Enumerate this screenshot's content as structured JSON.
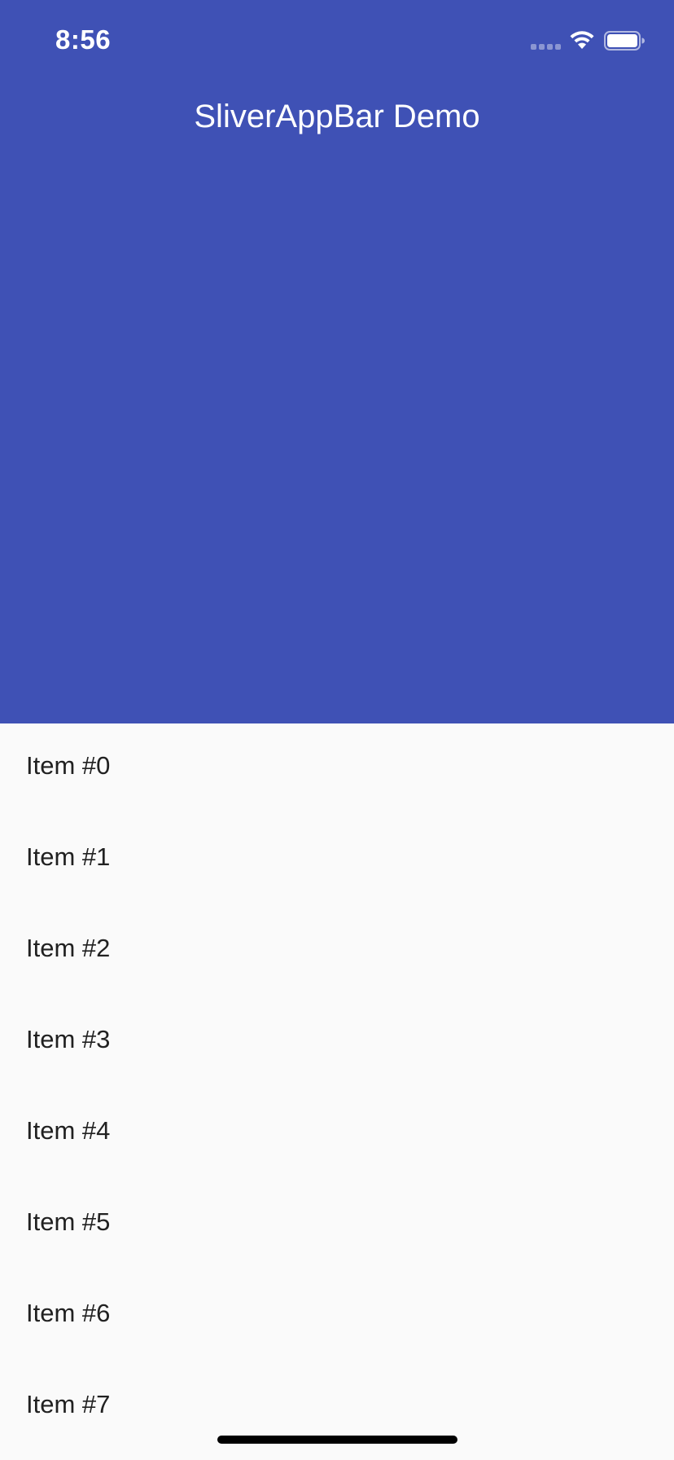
{
  "status_bar": {
    "time": "8:56",
    "icons": [
      "cellular-signal-icon",
      "wifi-icon",
      "battery-icon"
    ]
  },
  "app_bar": {
    "title": "SliverAppBar Demo",
    "background_color": "#3F51B5",
    "title_color": "#FFFFFF"
  },
  "list": {
    "items": [
      {
        "label": "Item #0"
      },
      {
        "label": "Item #1"
      },
      {
        "label": "Item #2"
      },
      {
        "label": "Item #3"
      },
      {
        "label": "Item #4"
      },
      {
        "label": "Item #5"
      },
      {
        "label": "Item #6"
      },
      {
        "label": "Item #7"
      }
    ]
  },
  "colors": {
    "background": "#FAFAFA",
    "text": "#212121"
  }
}
